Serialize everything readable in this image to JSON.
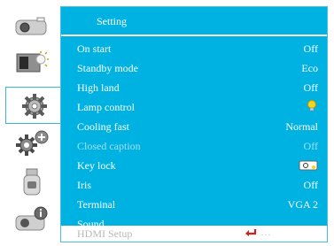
{
  "menu": {
    "title": "Setting",
    "items": [
      {
        "label": "On start",
        "value": "Off"
      },
      {
        "label": "Standby mode",
        "value": "Eco"
      },
      {
        "label": "High land",
        "value": "Off"
      },
      {
        "label": "Lamp control",
        "value": "",
        "icon": "bulb-icon"
      },
      {
        "label": "Cooling fast",
        "value": "Normal"
      },
      {
        "label": "Closed caption",
        "value": "Off",
        "disabled": true
      },
      {
        "label": "Key lock",
        "value": "",
        "icon": "key-lock-icon"
      },
      {
        "label": "Iris",
        "value": "Off"
      },
      {
        "label": "Terminal",
        "value": "VGA 2"
      },
      {
        "label": "Sound",
        "value": "......"
      }
    ],
    "hdmi_item": {
      "label": "HDMI Setup",
      "value": "…",
      "icon": "enter-arrow-icon"
    }
  },
  "sidebar": {
    "items": [
      {
        "name": "display-icon"
      },
      {
        "name": "image-adjust-icon"
      },
      {
        "name": "setting-gear-icon",
        "active": true
      },
      {
        "name": "expand-gear-plus-icon"
      },
      {
        "name": "usb-memory-icon"
      },
      {
        "name": "info-icon"
      }
    ]
  },
  "colors": {
    "panel": "#00b2e2",
    "text": "#ffffff",
    "disabled_text": "#9fe0f2",
    "enter_arrow": "#cc2222",
    "bulb": "#f2d51c"
  }
}
